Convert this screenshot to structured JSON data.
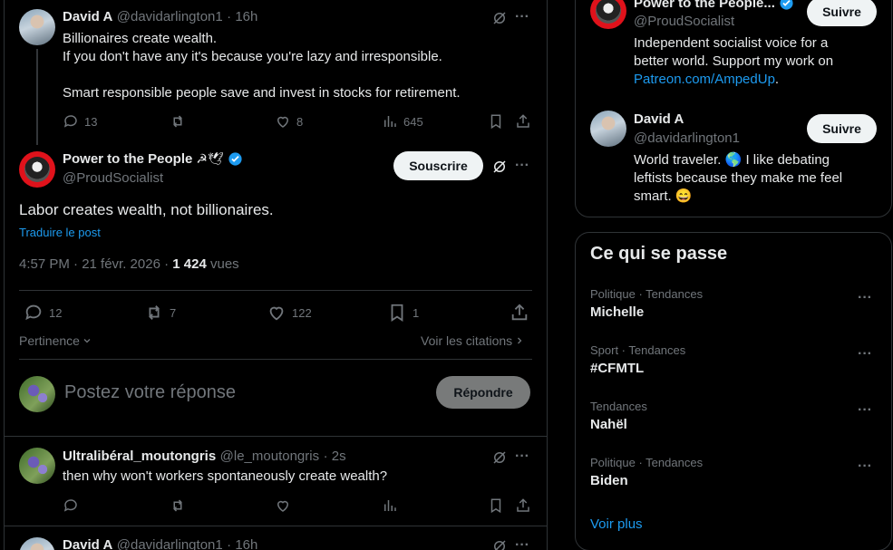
{
  "parent_post": {
    "author_name": "David A",
    "author_handle": "@davidarlington1",
    "time": "· 16h",
    "text_line1": "Billionaires create wealth.",
    "text_line2": "If you don't have any it's because you're lazy and irresponsible.",
    "text_line3": "Smart responsible people save and invest in stocks for retirement.",
    "replies": "13",
    "likes": "8",
    "views": "645"
  },
  "main_post": {
    "author_name": "Power to the People",
    "author_emoji": "☭🕊",
    "author_handle": "@ProudSocialist",
    "subscribe_label": "Souscrire",
    "text": "Labor creates wealth, not billionaires.",
    "translate_label": "Traduire le post",
    "timestamp": "4:57 PM · 21 févr. 2026 · ",
    "view_count": "1 424",
    "view_label": " vues",
    "replies": "12",
    "reposts": "7",
    "likes": "122",
    "bookmarks": "1",
    "sort_label": "Pertinence",
    "quotes_label": "Voir les citations"
  },
  "reply_box": {
    "placeholder": "Postez votre réponse",
    "reply_button": "Répondre"
  },
  "reply_post": {
    "author_name": "Ultralibéral_moutongris",
    "author_handle": "@le_moutongris",
    "time": "· 2s",
    "text": "then why won't workers spontaneously create wealth?"
  },
  "next_post": {
    "author_name": "David A",
    "author_handle": "@davidarlington1",
    "time": "· 16h"
  },
  "relevant_people": {
    "person1": {
      "name": "Power to the People...",
      "handle": "@ProudSocialist",
      "follow_label": "Suivre",
      "bio_line1": "Independent socialist voice for a",
      "bio_line2": "better world. Support my work on",
      "bio_link": "Patreon.com/AmpedUp",
      "bio_end": "."
    },
    "person2": {
      "name": "David A",
      "handle": "@davidarlington1",
      "follow_label": "Suivre",
      "bio_line1a": "World traveler. ",
      "bio_globe": "🌎",
      "bio_line1b": " I like debating",
      "bio_line2": "leftists because they make me feel",
      "bio_line3": "smart. ",
      "bio_emoji": "😄"
    }
  },
  "trends": {
    "title": "Ce qui se passe",
    "items": [
      {
        "category": "Politique · Tendances",
        "name": "Michelle"
      },
      {
        "category": "Sport · Tendances",
        "name": "#CFMTL"
      },
      {
        "category": "Tendances",
        "name": "Nahël"
      },
      {
        "category": "Politique · Tendances",
        "name": "Biden"
      }
    ],
    "show_more": "Voir plus"
  },
  "colors": {
    "background": "#000000",
    "accent": "#1d9bf0",
    "verified": "#1d9bf0",
    "muted": "#71767b",
    "border": "#2f3336"
  }
}
